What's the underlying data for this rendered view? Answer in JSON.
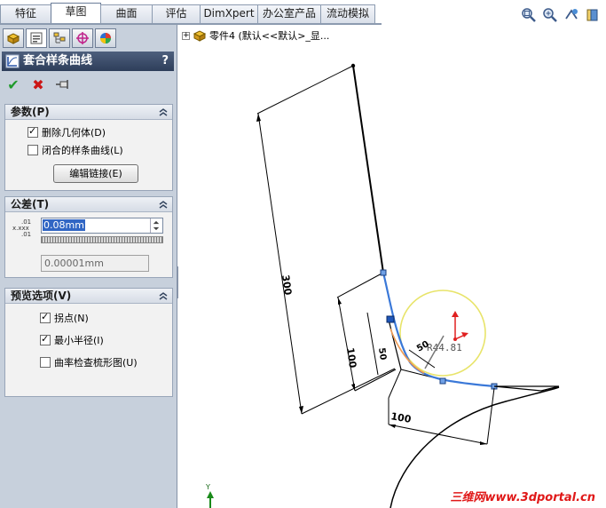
{
  "tabs": [
    {
      "label": "特征",
      "active": false
    },
    {
      "label": "草图",
      "active": true
    },
    {
      "label": "曲面",
      "active": false
    },
    {
      "label": "评估",
      "active": false
    },
    {
      "label": "DimXpert",
      "active": false
    },
    {
      "label": "办公室产品",
      "active": false
    },
    {
      "label": "流动模拟",
      "active": false
    }
  ],
  "view_toolbar": {
    "icons": [
      "zoom-to-fit-icon",
      "zoom-to-area-icon",
      "previous-view-icon",
      "section-view-icon"
    ]
  },
  "property_manager": {
    "panel_tabs": [
      "feature-manager-icon",
      "property-manager-icon",
      "configuration-manager-icon",
      "dimxpert-manager-icon",
      "display-manager-icon"
    ],
    "title": "套合样条曲线",
    "help": "?",
    "actions": {
      "ok": "✔",
      "cancel": "✖",
      "pin": "pin-icon"
    },
    "params": {
      "header": "参数(P)",
      "delete_geometry": "删除几何体(D)",
      "delete_geometry_checked": true,
      "closed_spline": "闭合的样条曲线(L)",
      "closed_spline_checked": false,
      "edit_links": "编辑链接(E)"
    },
    "tolerance": {
      "header": "公差(T)",
      "icon_top": ".01",
      "icon_mid": "x.xxx",
      "icon_bot": ".01",
      "value": "0.08mm",
      "min_value": "0.00001mm"
    },
    "preview": {
      "header": "预览选项(V)",
      "inflection_points": "拐点(N)",
      "inflection_points_checked": true,
      "min_radius": "最小半径(I)",
      "min_radius_checked": true,
      "curvature_comb": "曲率检查梳形图(U)",
      "curvature_comb_checked": false
    }
  },
  "feature_tree": {
    "expand": "+",
    "part_label": "零件4  (默认<<默认>_显..."
  },
  "sketch": {
    "dimensions": {
      "long_side": "300",
      "vertical_a": "100",
      "vertical_b": "50",
      "bottom": "100",
      "radius_b": "50",
      "min_radius": "R44.81"
    },
    "colors": {
      "spline": "#3a78d8",
      "circle": "#e8e46a",
      "handle": "#e02020",
      "geometry": "#000000"
    }
  },
  "triad": {
    "axis_label": "Y"
  },
  "watermark": "三维网www.3dportal.cn"
}
